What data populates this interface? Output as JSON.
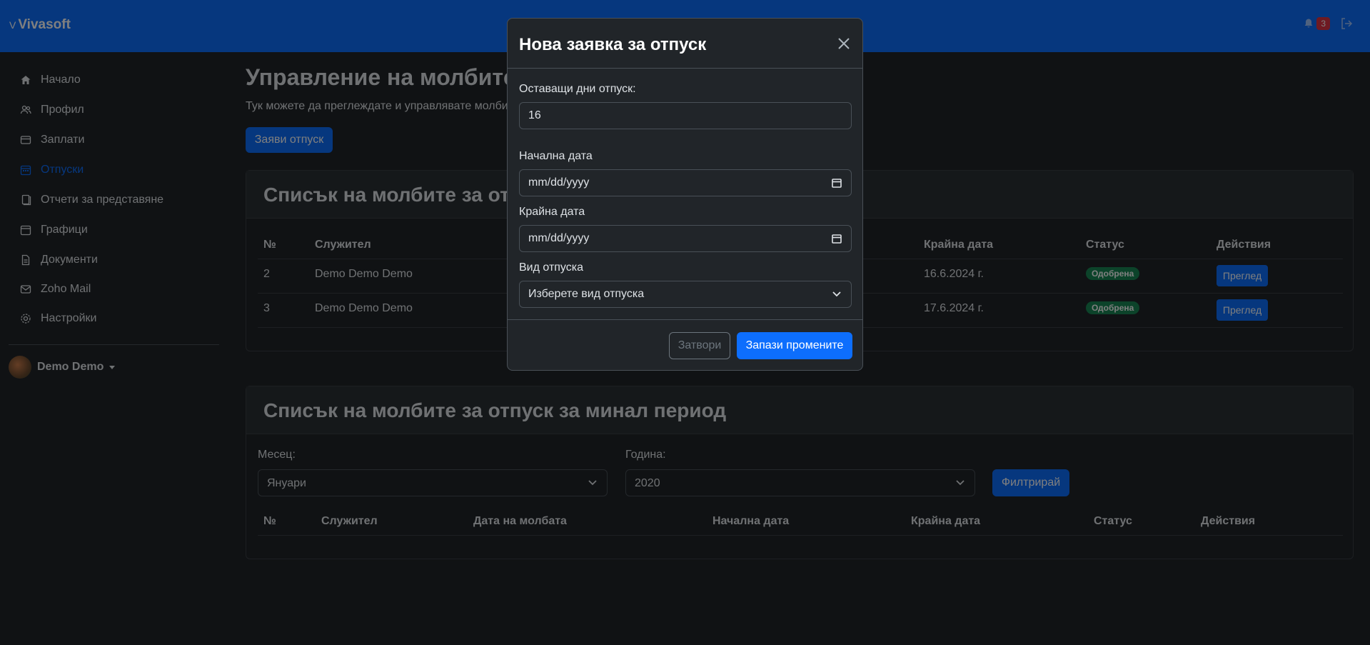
{
  "brand": {
    "name": "Vivasoft",
    "logo_mark": "V"
  },
  "notifications": {
    "count": "3"
  },
  "sidebar": {
    "items": [
      {
        "label": "Начало",
        "icon": "home-icon"
      },
      {
        "label": "Профил",
        "icon": "users-icon"
      },
      {
        "label": "Заплати",
        "icon": "credit-card-icon"
      },
      {
        "label": "Отпуски",
        "icon": "calendar-icon",
        "active": true
      },
      {
        "label": "Отчети за представяне",
        "icon": "files-icon"
      },
      {
        "label": "Графици",
        "icon": "calendar-icon"
      },
      {
        "label": "Документи",
        "icon": "document-icon"
      },
      {
        "label": "Zoho Mail",
        "icon": "mail-icon"
      },
      {
        "label": "Настройки",
        "icon": "gear-icon"
      }
    ],
    "user": "Demo Demo"
  },
  "main": {
    "title": "Управление на молбите за отпуск",
    "subtitle": "Тук можете да преглеждате и управлявате молбите си за отпуск",
    "request_button": "Заяви отпуск"
  },
  "current_list": {
    "title": "Списък на молбите за отпуск",
    "headers": [
      "№",
      "Служител",
      "Крайна дата",
      "Статус",
      "Действия"
    ],
    "rows": [
      {
        "no": "2",
        "employee": "Demo Demo Demo",
        "end_date": "16.6.2024 г.",
        "status": "Одобрена",
        "action": "Преглед"
      },
      {
        "no": "3",
        "employee": "Demo Demo Demo",
        "end_date": "17.6.2024 г.",
        "status": "Одобрена",
        "action": "Преглед"
      }
    ]
  },
  "past_list": {
    "title": "Списък на молбите за отпуск за минал период",
    "month_label": "Месец:",
    "month_value": "Януари",
    "year_label": "Година:",
    "year_value": "2020",
    "filter_button": "Филтрирай",
    "headers": [
      "№",
      "Служител",
      "Дата на молбата",
      "Начална дата",
      "Крайна дата",
      "Статус",
      "Действия"
    ]
  },
  "modal": {
    "title": "Нова заявка за отпуск",
    "remaining_label": "Оставащи дни отпуск:",
    "remaining_value": "16",
    "start_label": "Начална дата",
    "start_placeholder": "mm/dd/yyyy",
    "end_label": "Крайна дата",
    "end_placeholder": "mm/dd/yyyy",
    "type_label": "Вид отпуска",
    "type_value": "Изберете вид отпуска",
    "close_button": "Затвори",
    "save_button": "Запази промените"
  },
  "colors": {
    "primary": "#0d6efd",
    "success": "#198754",
    "danger": "#dc3545",
    "background": "#212529"
  }
}
